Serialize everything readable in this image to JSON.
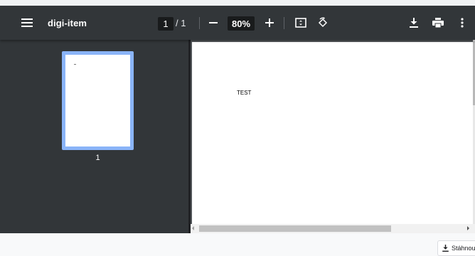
{
  "toolbar": {
    "title": "digi-item",
    "page_current": "1",
    "page_total": "/ 1",
    "zoom": "80%",
    "icons": {
      "menu": "menu-icon",
      "zoom_out": "minus-icon",
      "zoom_in": "plus-icon",
      "fit": "fit-to-page-icon",
      "rotate": "rotate-icon",
      "download": "download-icon",
      "print": "print-icon",
      "more": "more-vert-icon"
    }
  },
  "sidebar": {
    "thumbnails": [
      {
        "page_number": "1",
        "selected": true
      }
    ]
  },
  "document": {
    "text": "TEST"
  },
  "downloads_bar": {
    "item_label": "Stáhnou"
  },
  "colors": {
    "toolbar": "#323639",
    "viewer_bg": "#525659",
    "thumb_selected": "#8ab4f8"
  }
}
